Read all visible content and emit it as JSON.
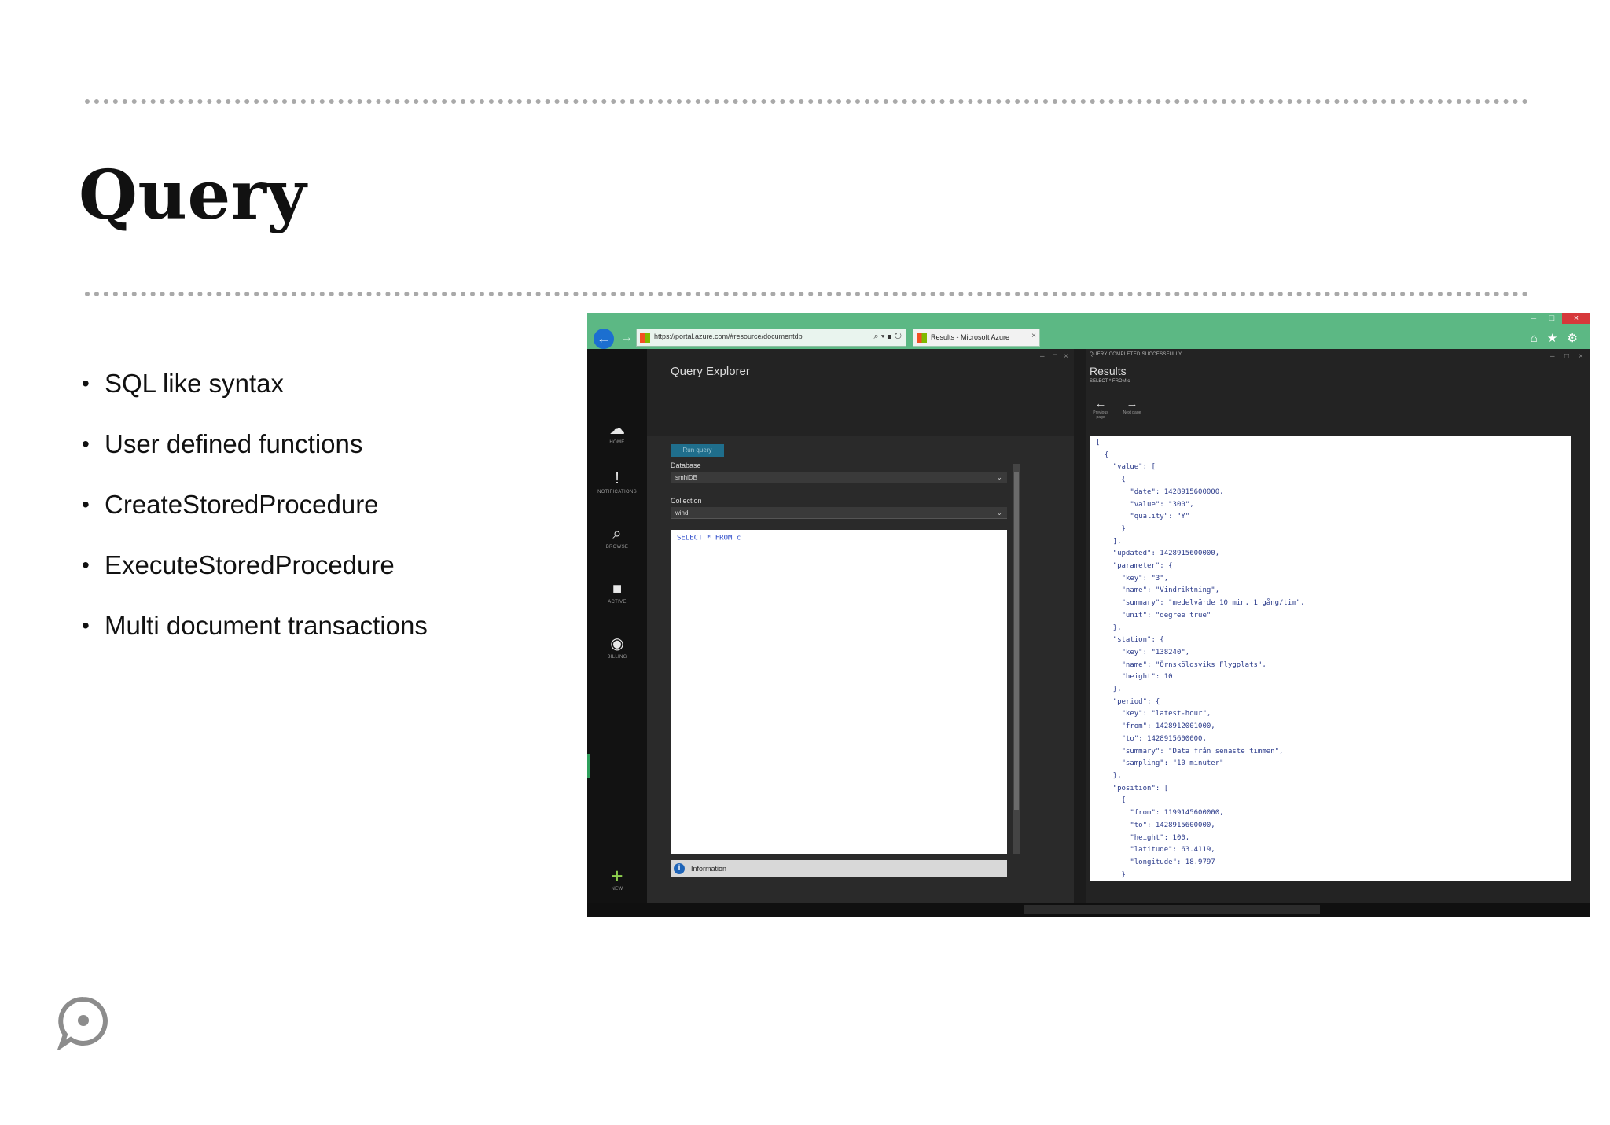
{
  "slide": {
    "title": "Query",
    "bullets": [
      "SQL like syntax",
      "User defined functions",
      "CreateStoredProcedure",
      "ExecuteStoredProcedure",
      "Multi document transactions"
    ]
  },
  "browser": {
    "url": "https://portal.azure.com/#resource/documentdb",
    "tab_title": "Results - Microsoft Azure",
    "tab_close": "×",
    "minimize": "–",
    "maximize": "□",
    "close": "×",
    "back_icon": "arrow-left-icon",
    "toolbar_icons": "⌂ ★ ⚙"
  },
  "left_nav": {
    "items": [
      {
        "label": "HOME",
        "icon": "☁"
      },
      {
        "label": "NOTIFICATIONS",
        "icon": "!"
      },
      {
        "label": "BROWSE",
        "icon": "⌕"
      },
      {
        "label": "ACTIVE",
        "icon": "■"
      },
      {
        "label": "BILLING",
        "icon": "◉"
      }
    ],
    "new": {
      "label": "NEW",
      "icon": "+"
    }
  },
  "query_explorer": {
    "title": "Query Explorer",
    "run_label": "Run query",
    "database_label": "Database",
    "database_value": "smhiDB",
    "collection_label": "Collection",
    "collection_value": "wind",
    "query_text": "SELECT * FROM c",
    "info_label": "Information"
  },
  "results": {
    "status": "QUERY COMPLETED SUCCESSFULLY",
    "title": "Results",
    "subtitle": "SELECT * FROM c",
    "previous_label": "Previous page",
    "next_label": "Next page",
    "json": "[\n  {\n    \"value\": [\n      {\n        \"date\": 1428915600000,\n        \"value\": \"300\",\n        \"quality\": \"Y\"\n      }\n    ],\n    \"updated\": 1428915600000,\n    \"parameter\": {\n      \"key\": \"3\",\n      \"name\": \"Vindriktning\",\n      \"summary\": \"medelvärde 10 min, 1 gång/tim\",\n      \"unit\": \"degree true\"\n    },\n    \"station\": {\n      \"key\": \"138240\",\n      \"name\": \"Örnsköldsviks Flygplats\",\n      \"height\": 10\n    },\n    \"period\": {\n      \"key\": \"latest-hour\",\n      \"from\": 1428912001000,\n      \"to\": 1428915600000,\n      \"summary\": \"Data från senaste timmen\",\n      \"sampling\": \"10 minuter\"\n    },\n    \"position\": [\n      {\n        \"from\": 1199145600000,\n        \"to\": 1428915600000,\n        \"height\": 100,\n        \"latitude\": 63.4119,\n        \"longitude\": 18.9797\n      }\n    ],"
  },
  "colors": {
    "browser_bar": "#5cb884",
    "portal_dark": "#1c1c1c",
    "accent_blue": "#1e64b8",
    "close_red": "#d6383a"
  }
}
